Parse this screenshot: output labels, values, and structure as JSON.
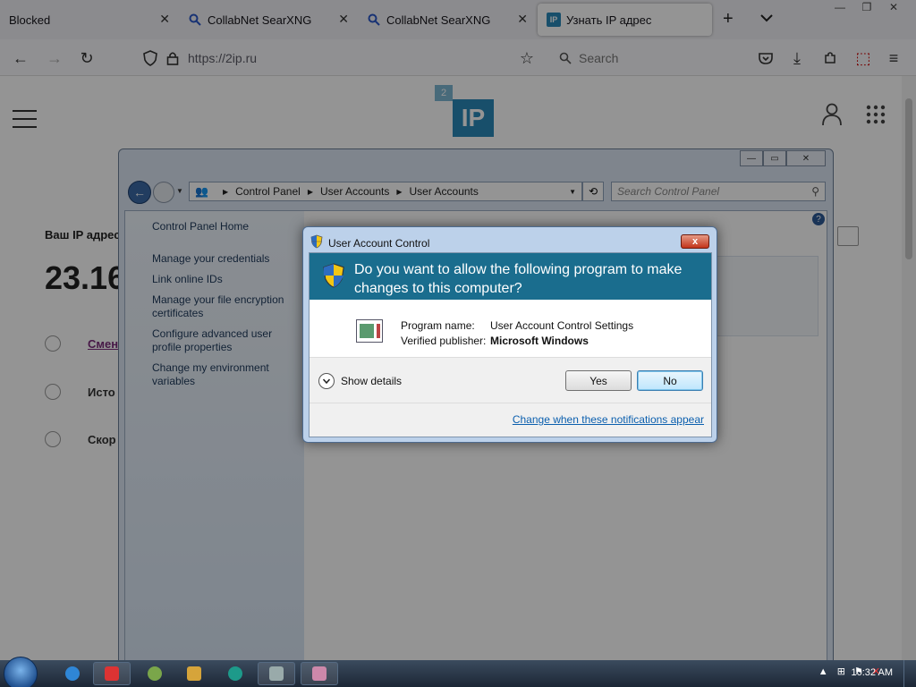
{
  "browser": {
    "tabs": [
      {
        "title": "Blocked",
        "icon": "none",
        "active": false
      },
      {
        "title": "CollabNet SearXNG",
        "icon": "search-icon",
        "active": false
      },
      {
        "title": "CollabNet SearXNG",
        "icon": "search-icon",
        "active": false
      },
      {
        "title": "Узнать IP адрес",
        "icon": "ip-favicon",
        "active": true
      }
    ],
    "new_tab": "+",
    "tab_list": "⌄",
    "url": "https://2ip.ru",
    "search_placeholder": "Search"
  },
  "site": {
    "logo_text": "IP",
    "logo_badge": "2",
    "ip_label": "Ваш IP адрес",
    "ip_value": "23.16",
    "rows": [
      "Смен",
      "Исто",
      "Скор"
    ]
  },
  "control_panel": {
    "path": [
      "Control Panel",
      "User Accounts",
      "User Accounts"
    ],
    "search_placeholder": "Search Control Panel",
    "links": [
      "Control Panel Home",
      "Manage your credentials",
      "Link online IDs",
      "Manage your file encryption certificates",
      "Configure advanced user profile properties",
      "Change my environment variables"
    ],
    "help": "?"
  },
  "uac": {
    "title": "User Account Control",
    "close": "x",
    "question": "Do you want to allow the following program to make changes to this computer?",
    "program_name_label": "Program name:",
    "program_name": "User Account Control Settings",
    "publisher_label": "Verified publisher:",
    "publisher": "Microsoft Windows",
    "show_details": "Show details",
    "yes": "Yes",
    "no": "No",
    "notifications_link": "Change when these notifications appear"
  },
  "taskbar": {
    "clock": "10:32 AM"
  }
}
